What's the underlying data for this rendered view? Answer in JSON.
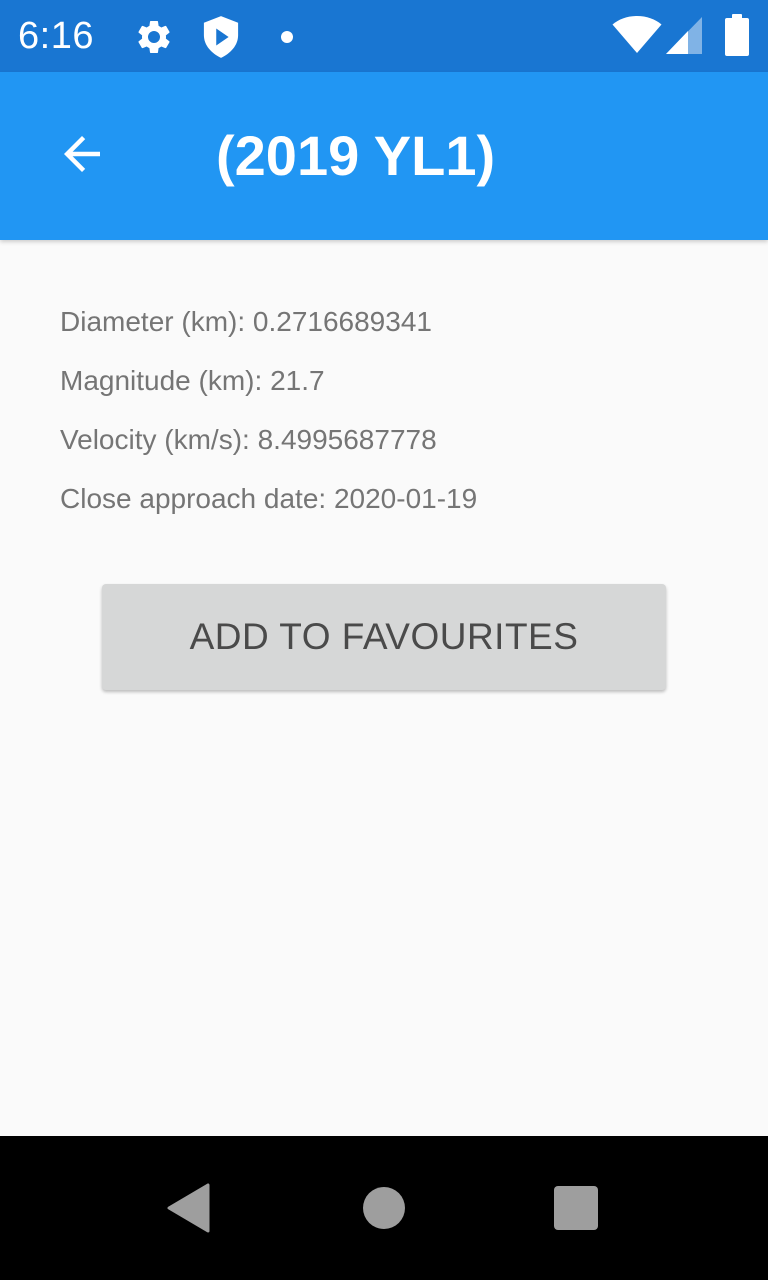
{
  "status_bar": {
    "time": "6:16",
    "icons": [
      "gear-icon",
      "shield-play-icon",
      "notification-dot-icon",
      "wifi-icon",
      "cell-signal-icon",
      "battery-icon"
    ],
    "color": "#1976d2"
  },
  "app_bar": {
    "title": "(2019 YL1)",
    "back_icon": "arrow-back-icon",
    "color": "#2196f3"
  },
  "details": {
    "diameter": "Diameter (km): 0.2716689341",
    "magnitude": "Magnitude (km): 21.7",
    "velocity": "Velocity (km/s): 8.4995687778",
    "close_approach": "Close approach date: 2020-01-19"
  },
  "actions": {
    "add_favourites_label": "ADD TO FAVOURITES"
  },
  "nav_bar": {
    "icons": [
      "back-triangle-icon",
      "home-circle-icon",
      "recents-square-icon"
    ]
  }
}
